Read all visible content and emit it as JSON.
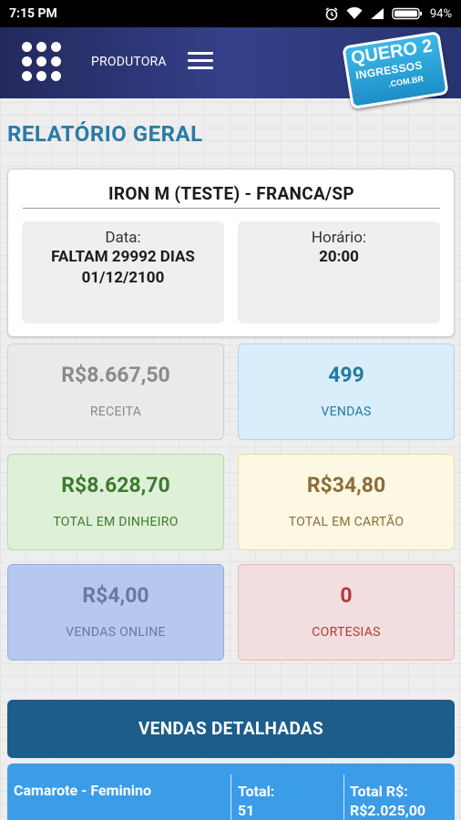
{
  "status_bar": {
    "time": "7:15 PM",
    "battery": "94%",
    "icons": [
      "alarm-icon",
      "wifi-icon",
      "signal-icon",
      "battery-icon"
    ]
  },
  "app_bar": {
    "brand_label": "PRODUTORA",
    "logo": {
      "line1": "QUERO 2",
      "line2": "INGRESSOS",
      "line3": ".COM.BR"
    }
  },
  "page": {
    "title": "RELATÓRIO GERAL"
  },
  "event": {
    "name": "IRON M (TESTE) - FRANCA/SP",
    "date_label": "Data:",
    "date_countdown": "FALTAM 29992 DIAS",
    "date_value": "01/12/2100",
    "time_label": "Horário:",
    "time_value": "20:00"
  },
  "stats": {
    "receita": {
      "value": "R$8.667,50",
      "label": "RECEITA"
    },
    "vendas": {
      "value": "499",
      "label": "VENDAS"
    },
    "dinheiro": {
      "value": "R$8.628,70",
      "label": "TOTAL EM DINHEIRO"
    },
    "cartao": {
      "value": "R$34,80",
      "label": "TOTAL EM CARTÃO"
    },
    "online": {
      "value": "R$4,00",
      "label": "VENDAS ONLINE"
    },
    "cortesias": {
      "value": "0",
      "label": "CORTESIAS"
    }
  },
  "details": {
    "header": "VENDAS DETALHADAS",
    "rows": [
      {
        "name": "Camarote - Feminino",
        "total_label": "Total:",
        "total_value": "51",
        "amount_label": "Total R$:",
        "amount_value": "R$2.025,00"
      }
    ]
  },
  "colors": {
    "app_bar": "#2b3270",
    "title": "#2a7ba6",
    "detail_header": "#1c5d8a",
    "detail_row": "#3b9ce8"
  }
}
